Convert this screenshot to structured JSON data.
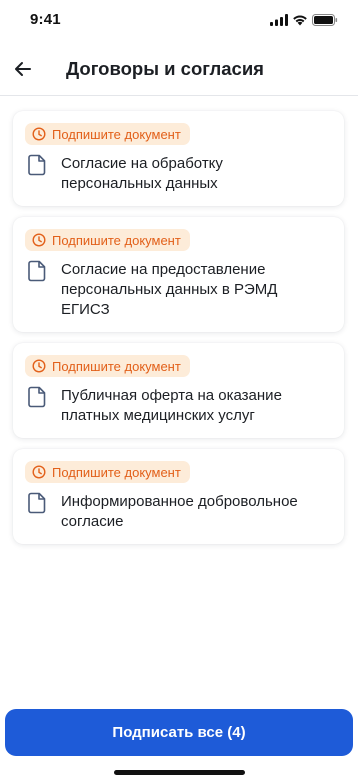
{
  "status_bar": {
    "time": "9:41",
    "icons": [
      "cellular-signal-icon",
      "wifi-icon",
      "battery-icon"
    ]
  },
  "header": {
    "back_icon": "arrow-left-icon",
    "title": "Договоры и согласия"
  },
  "documents": [
    {
      "badge": "Подпишите документ",
      "title": "Согласие на обработку\nперсональных данных"
    },
    {
      "badge": "Подпишите документ",
      "title": "Согласие на предоставление\nперсональных данных в РЭМД\nЕГИСЗ"
    },
    {
      "badge": "Подпишите документ",
      "title": "Публичная оферта на оказание\nплатных медицинских услуг"
    },
    {
      "badge": "Подпишите документ",
      "title": "Информированное добровольное\nсогласие"
    }
  ],
  "footer": {
    "sign_all_label": "Подписать все (4)"
  },
  "colors": {
    "accent": "#1e5bd8",
    "badge_bg": "#fdecd9",
    "badge_text": "#e2601a",
    "doc_icon": "#4a5a78"
  }
}
